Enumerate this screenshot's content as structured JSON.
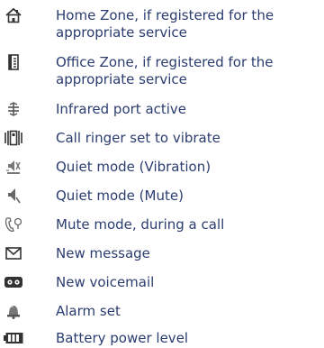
{
  "items": [
    {
      "icon": "home-zone-icon",
      "label": "Home Zone, if registered for the appropriate service"
    },
    {
      "icon": "office-zone-icon",
      "label": "Office Zone, if registered for the appropriate service"
    },
    {
      "icon": "infrared-icon",
      "label": "Infrared port active"
    },
    {
      "icon": "vibrate-icon",
      "label": "Call ringer set to vibrate"
    },
    {
      "icon": "quiet-vibration-icon",
      "label": "Quiet mode (Vibration)"
    },
    {
      "icon": "quiet-mute-icon",
      "label": "Quiet mode (Mute)"
    },
    {
      "icon": "mute-call-icon",
      "label": "Mute mode, during a call"
    },
    {
      "icon": "envelope-icon",
      "label": "New message"
    },
    {
      "icon": "voicemail-icon",
      "label": "New voicemail"
    },
    {
      "icon": "alarm-bell-icon",
      "label": "Alarm set"
    },
    {
      "icon": "battery-icon",
      "label": "Battery power level"
    }
  ]
}
